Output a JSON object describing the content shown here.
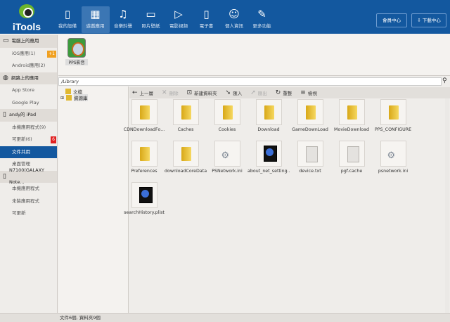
{
  "app": {
    "name": "iTools"
  },
  "nav": [
    {
      "label": "我的設備",
      "icon": "tablet-icon",
      "glyph": "▯"
    },
    {
      "label": "遊戲應用",
      "icon": "apps-grid-icon",
      "glyph": "▦"
    },
    {
      "label": "音樂鈴聲",
      "icon": "music-icon",
      "glyph": "♫"
    },
    {
      "label": "照片壁紙",
      "icon": "image-icon",
      "glyph": "▭"
    },
    {
      "label": "電影視頻",
      "icon": "play-icon",
      "glyph": "▷"
    },
    {
      "label": "電子書",
      "icon": "book-icon",
      "glyph": "▯"
    },
    {
      "label": "個人資訊",
      "icon": "user-icon",
      "glyph": "☺"
    },
    {
      "label": "更多功能",
      "icon": "wrench-icon",
      "glyph": "✎"
    }
  ],
  "header_buttons": {
    "member": "會員中心",
    "download": "下載中心"
  },
  "sidebar": {
    "sections": [
      {
        "title": "電腦上的應用",
        "icon": "monitor-icon",
        "glyph": "▭",
        "items": [
          {
            "label": "iOS應用(1)",
            "badge": "+1",
            "badge_color": "#f0a020"
          },
          {
            "label": "Android應用(2)"
          }
        ]
      },
      {
        "title": "網路上的應用",
        "icon": "globe-icon",
        "glyph": "◍",
        "items": [
          {
            "label": "App Store"
          },
          {
            "label": "Google Play"
          }
        ]
      },
      {
        "title": "andy的 iPad",
        "icon": "tablet-icon",
        "glyph": "▯",
        "items": [
          {
            "label": "本機應用程式(9)"
          },
          {
            "label": "可更新(6)",
            "badge": "6",
            "badge_color": "#e02020"
          },
          {
            "label": "文件共用",
            "active": true
          },
          {
            "label": "桌面管理"
          }
        ]
      },
      {
        "title": "N7100(GALAXY Note...",
        "icon": "phone-icon",
        "glyph": "▯",
        "items": [
          {
            "label": "本機應用程式"
          },
          {
            "label": "未裝應用程式"
          },
          {
            "label": "可更新"
          }
        ]
      }
    ]
  },
  "app_area": {
    "app_label": "PPS影音"
  },
  "path": "/Library",
  "tree": [
    {
      "label": "文檔"
    },
    {
      "label": "資源庫"
    }
  ],
  "toolbar": [
    {
      "label": "上一層",
      "glyph": "←",
      "icon": "back-arrow-icon"
    },
    {
      "label": "刪除",
      "glyph": "✕",
      "icon": "delete-icon",
      "disabled": true
    },
    {
      "label": "新建資料夾",
      "glyph": "⊡",
      "icon": "new-folder-icon"
    },
    {
      "label": "匯入",
      "glyph": "➘",
      "icon": "import-icon"
    },
    {
      "label": "匯出",
      "glyph": "➚",
      "icon": "export-icon",
      "disabled": true
    },
    {
      "label": "重整",
      "glyph": "↻",
      "icon": "refresh-icon"
    },
    {
      "label": "檢視",
      "glyph": "≡",
      "icon": "view-icon"
    }
  ],
  "files": [
    {
      "name": "CDNDownloadFo...",
      "type": "folder"
    },
    {
      "name": "Caches",
      "type": "folder"
    },
    {
      "name": "Cookies",
      "type": "folder"
    },
    {
      "name": "Download",
      "type": "folder"
    },
    {
      "name": "GameDownLoad",
      "type": "folder"
    },
    {
      "name": "MovieDownload",
      "type": "folder"
    },
    {
      "name": "PPS_CONFIGURE",
      "type": "folder"
    },
    {
      "name": "Preferences",
      "type": "folder"
    },
    {
      "name": "downloadCoreData",
      "type": "folder"
    },
    {
      "name": "PSNetwork.ini",
      "type": "cfg"
    },
    {
      "name": "about_net_setting....",
      "type": "plist"
    },
    {
      "name": "device.txt",
      "type": "doc"
    },
    {
      "name": "pgf.cache",
      "type": "doc"
    },
    {
      "name": "psnetwork.ini",
      "type": "cfg"
    },
    {
      "name": "searchHistory.plist",
      "type": "plist"
    }
  ],
  "status": "文件6個, 資料夾9個"
}
